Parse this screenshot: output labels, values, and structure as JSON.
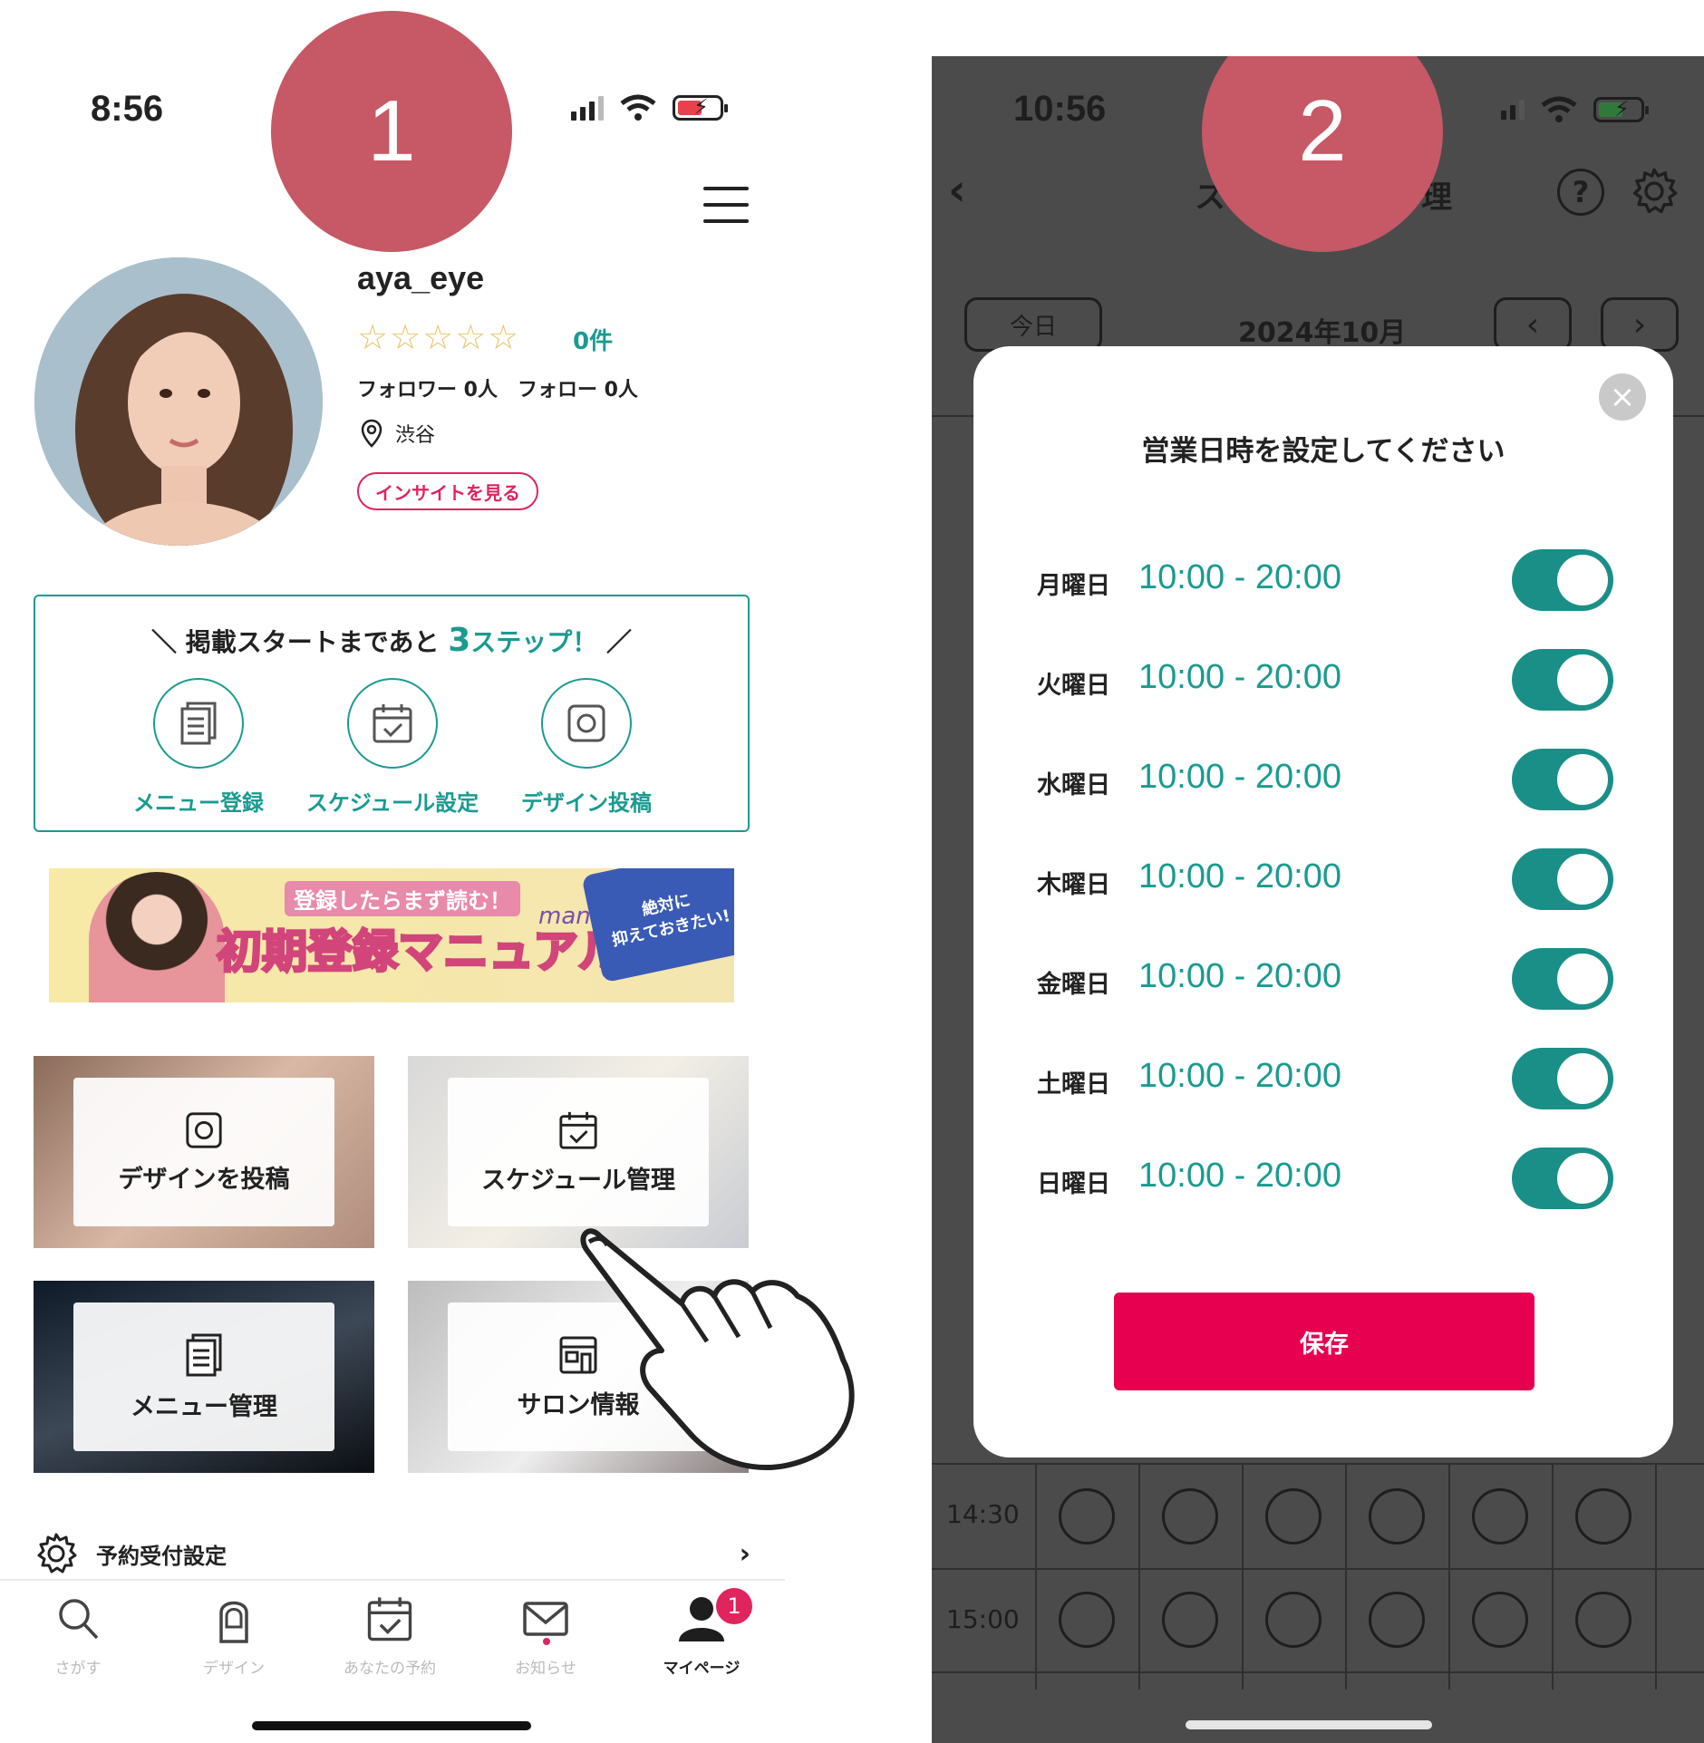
{
  "left_phone": {
    "status_time": "8:56",
    "step_badge": "1",
    "profile": {
      "username": "aya_eye",
      "stars": "☆☆☆☆☆",
      "review_count": "0件",
      "follow_text": "フォロワー 0人　フォロー 0人",
      "location": "渋谷",
      "insight_label": "インサイトを見る"
    },
    "steps": {
      "title_prefix": "＼ 掲載スタートまであと ",
      "title_number": "3",
      "title_suffix": "ステップ！",
      "title_end": " ／",
      "items": [
        {
          "label": "メニュー登録",
          "icon": "document-icon"
        },
        {
          "label": "スケジュール設定",
          "icon": "calendar-check-icon"
        },
        {
          "label": "デザイン投稿",
          "icon": "camera-icon"
        }
      ]
    },
    "banner": {
      "subtitle": "登録したらまず読む！",
      "title": "初期登録マニュアル",
      "script": "manual",
      "tag": "絶対に\n抑えておきたい!"
    },
    "tiles": [
      {
        "label": "デザインを投稿",
        "icon": "camera-icon"
      },
      {
        "label": "スケジュール管理",
        "icon": "calendar-check-icon"
      },
      {
        "label": "メニュー管理",
        "icon": "document-icon"
      },
      {
        "label": "サロン情報",
        "icon": "storefront-icon"
      }
    ],
    "settings_row": {
      "label": "予約受付設定",
      "chevron": "›"
    },
    "tabbar": [
      {
        "label": "さがす",
        "icon": "search-icon"
      },
      {
        "label": "デザイン",
        "icon": "nail-icon"
      },
      {
        "label": "あなたの予約",
        "icon": "calendar-check-icon"
      },
      {
        "label": "お知らせ",
        "icon": "mail-icon"
      },
      {
        "label": "マイページ",
        "icon": "person-icon"
      }
    ],
    "notification_count": "1"
  },
  "right_phone": {
    "status_time": "10:56",
    "step_badge": "2",
    "header_title_visible": "ス",
    "header_title_tail": "理",
    "today_label": "今日",
    "month_label": "2024年10月",
    "prev_arrow": "‹",
    "next_arrow": "›",
    "question_icon": "?",
    "schedule_times": [
      "14:30",
      "15:00"
    ],
    "modal": {
      "title": "営業日時を設定してください",
      "close": "×",
      "days": [
        {
          "day": "月曜日",
          "hours": "10:00 - 20:00",
          "enabled": true
        },
        {
          "day": "火曜日",
          "hours": "10:00 - 20:00",
          "enabled": true
        },
        {
          "day": "水曜日",
          "hours": "10:00 - 20:00",
          "enabled": true
        },
        {
          "day": "木曜日",
          "hours": "10:00 - 20:00",
          "enabled": true
        },
        {
          "day": "金曜日",
          "hours": "10:00 - 20:00",
          "enabled": true
        },
        {
          "day": "土曜日",
          "hours": "10:00 - 20:00",
          "enabled": true
        },
        {
          "day": "日曜日",
          "hours": "10:00 - 20:00",
          "enabled": true
        }
      ],
      "save_label": "保存"
    }
  },
  "colors": {
    "teal": "#1a9b91",
    "pink": "#e0245e",
    "badge": "#c75866",
    "overlay": "#4b4b4b"
  }
}
